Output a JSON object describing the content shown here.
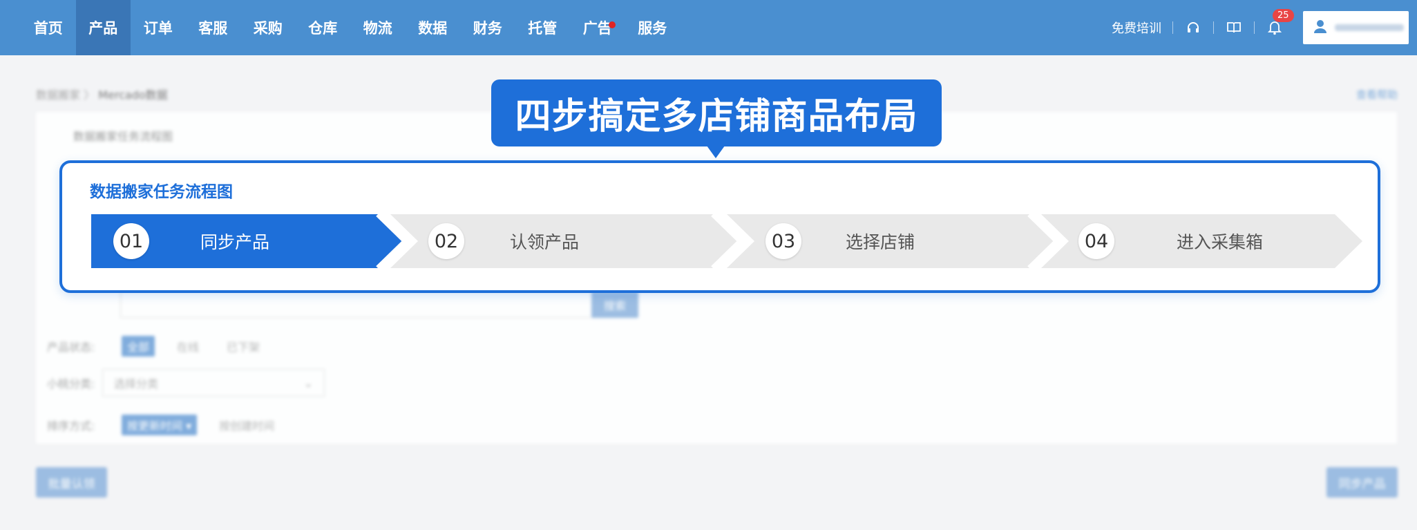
{
  "nav": {
    "items": [
      {
        "label": "首页"
      },
      {
        "label": "产品",
        "active": true
      },
      {
        "label": "订单"
      },
      {
        "label": "客服"
      },
      {
        "label": "采购"
      },
      {
        "label": "仓库"
      },
      {
        "label": "物流"
      },
      {
        "label": "数据"
      },
      {
        "label": "财务"
      },
      {
        "label": "托管"
      },
      {
        "label": "广告",
        "dot": true
      },
      {
        "label": "服务"
      }
    ],
    "free_training": "免费培训",
    "notification_count": "25",
    "icons": [
      "headset-icon",
      "book-icon",
      "bell-icon",
      "user-icon"
    ]
  },
  "page": {
    "breadcrumb_parent": "数据搬家",
    "breadcrumb_sep": "〉",
    "breadcrumb_current": "Mercado数据",
    "help_link": "查看帮助",
    "panel_title": "数据搬家任务流程图",
    "search_button": "搜索",
    "filters": {
      "status_label": "产品状态:",
      "status_options": [
        "全部",
        "在线",
        "已下架"
      ],
      "category_label": "小桃分类:",
      "category_placeholder": "选择分类",
      "sort_label": "排序方式:",
      "sort_options": [
        "按更新时间 ▾",
        "按创建时间"
      ]
    },
    "bulk_claim_button": "批量认领",
    "sync_products_button": "同步产品"
  },
  "callout": {
    "headline": "四步搞定多店铺商品布局"
  },
  "flow": {
    "title": "数据搬家任务流程图",
    "steps": [
      {
        "num": "01",
        "label": "同步产品",
        "active": true
      },
      {
        "num": "02",
        "label": "认领产品"
      },
      {
        "num": "03",
        "label": "选择店铺"
      },
      {
        "num": "04",
        "label": "进入采集箱"
      }
    ]
  },
  "colors": {
    "topbar": "#4a8fd0",
    "accent": "#1e6fd9",
    "step_inactive": "#e9e9e9"
  }
}
